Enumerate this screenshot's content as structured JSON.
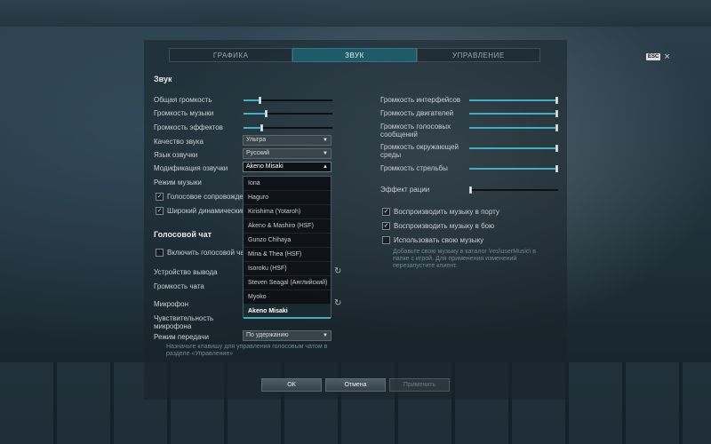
{
  "tabs": [
    {
      "label": "ГРАФИКА",
      "active": false
    },
    {
      "label": "ЗВУК",
      "active": true
    },
    {
      "label": "УПРАВЛЕНИЕ",
      "active": false
    }
  ],
  "esc_label": "ESC",
  "close_glyph": "×",
  "sound": {
    "title": "Звук",
    "master_volume": {
      "label": "Общая громкость",
      "value": 0.18
    },
    "music_volume": {
      "label": "Громкость музыки",
      "value": 0.25
    },
    "effects_volume": {
      "label": "Громкость эффектов",
      "value": 0.2
    },
    "quality": {
      "label": "Качество звука",
      "value": "Ультра"
    },
    "voice_language": {
      "label": "Язык озвучки",
      "value": "Русский"
    },
    "voice_mod": {
      "label": "Модификация озвучки",
      "value": "Akeno Misaki"
    },
    "music_mode": {
      "label": "Режим музыки"
    },
    "voice_support": {
      "label": "Голосовое сопровождение",
      "checked": true
    },
    "wide_dynamic": {
      "label": "Широкий динамический д",
      "checked": true
    }
  },
  "right": {
    "interface_volume": {
      "label": "Громкость интерфейсов",
      "value": 1.0
    },
    "engine_volume": {
      "label": "Громкость двигателей",
      "value": 1.0
    },
    "voice_msg_volume": {
      "label": "Громкость голосовых сообщений",
      "value": 1.0
    },
    "ambient_volume": {
      "label": "Громкость окружающей среды",
      "value": 1.0
    },
    "gunfire_volume": {
      "label": "Громкость стрельбы",
      "value": 1.0
    },
    "radio_effect": {
      "label": "Эффект рации",
      "value": 0.0
    },
    "music_port": {
      "label": "Воспроизводить музыку в порту",
      "checked": true
    },
    "music_battle": {
      "label": "Воспроизводить музыку в бою",
      "checked": true
    },
    "own_music": {
      "label": "Использовать свою музыку",
      "checked": false
    },
    "own_music_hint": "Добавьте свою музыку в каталог \\res\\userMusic\\ в папке с игрой. Для применения изменений перезапустите клиент."
  },
  "voice_chat": {
    "title": "Голосовой чат",
    "enable": {
      "label": "Включить голосовой чат",
      "checked": false
    },
    "output_device": {
      "label": "Устройство вывода"
    },
    "chat_volume": {
      "label": "Громкость чата"
    },
    "microphone": {
      "label": "Микрофон"
    },
    "mic_sensitivity": {
      "label": "Чувствительность микрофона"
    },
    "transmit_mode": {
      "label": "Режим передачи",
      "value": "По удержанию"
    },
    "hint": "Назначьте клавишу для управления голосовым чатом в разделе «Управление»"
  },
  "voice_mod_options": [
    "Iona",
    "Haguro",
    "Kirishima (Yotaroh)",
    "Akeno & Mashiro (HSF)",
    "Gunzo Chihaya",
    "Mina & Thea (HSF)",
    "Isoroku (HSF)",
    "Steven Seagal (Английский)",
    "Myoko",
    "Akeno Misaki"
  ],
  "buttons": {
    "ok": "ОК",
    "cancel": "Отмена",
    "apply": "Применить"
  }
}
